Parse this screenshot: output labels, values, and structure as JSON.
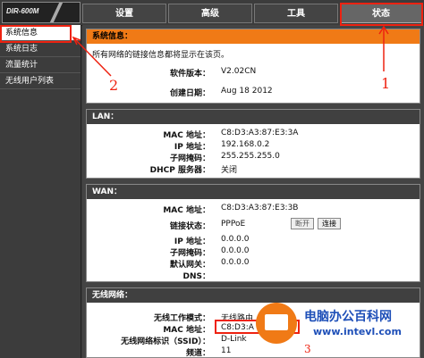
{
  "header": {
    "logo": "DIR-600M"
  },
  "tabs": [
    {
      "label": "设置"
    },
    {
      "label": "高级"
    },
    {
      "label": "工具"
    },
    {
      "label": "状态"
    }
  ],
  "sidebar": {
    "items": [
      {
        "label": "系统信息"
      },
      {
        "label": "系统日志"
      },
      {
        "label": "流量统计"
      },
      {
        "label": "无线用户列表"
      }
    ]
  },
  "system_info": {
    "title": "系统信息：",
    "description": "所有网络的链接信息都将显示在该页。",
    "firmware_label": "软件版本：",
    "firmware_value": "V2.02CN",
    "build_label": "创建日期：",
    "build_value": "Aug 18 2012"
  },
  "lan": {
    "title": "LAN：",
    "mac_label": "MAC 地址：",
    "mac_value": "C8:D3:A3:87:E3:3A",
    "ip_label": "IP 地址：",
    "ip_value": "192.168.0.2",
    "mask_label": "子网掩码：",
    "mask_value": "255.255.255.0",
    "dhcp_label": "DHCP 服务器：",
    "dhcp_value": "关闭"
  },
  "wan": {
    "title": "WAN：",
    "mac_label": "MAC 地址：",
    "mac_value": "C8:D3:A3:87:E3:3B",
    "status_label": "链接状态：",
    "status_value": "PPPoE",
    "disconnect_label": "断开",
    "connect_label": "连接",
    "ip_label": "IP 地址：",
    "ip_value": "0.0.0.0",
    "mask_label": "子网掩码：",
    "mask_value": "0.0.0.0",
    "gateway_label": "默认网关：",
    "gateway_value": "0.0.0.0",
    "dns_label": "DNS：",
    "dns_value": ""
  },
  "wireless": {
    "title": "无线网络：",
    "mode_label": "无线工作模式：",
    "mode_value": "无线路由",
    "mac_label": "MAC 地址：",
    "mac_value": "C8:D3:A",
    "ssid_label": "无线网络标识（SSID）：",
    "ssid_value": "D-Link",
    "channel_label": "频道：",
    "channel_value": "11"
  },
  "annotations": {
    "one": "1",
    "two": "2",
    "three": "3"
  },
  "watermark": {
    "title": "电脑办公百科网",
    "url": "www.intevl.com"
  },
  "colors": {
    "accent": "#f07a16",
    "annotation": "#ee2211",
    "watermark": "#1e4fb8"
  }
}
